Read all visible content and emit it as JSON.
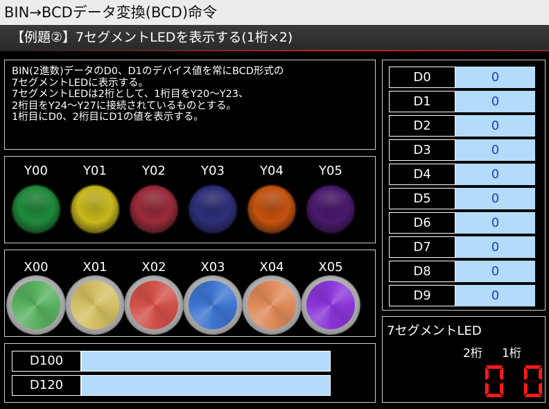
{
  "title": "BIN→BCDデータ変換(BCD)命令",
  "subtitle": "【例題②】7セグメントLEDを表示する(1桁×2)",
  "description": "BIN(2進数)データのD0、D1のデバイス値を常にBCD形式の\n7セグメントLEDに表示する。\n7セグメントLEDは2桁として、1桁目をY20～Y23、\n2桁目をY24～Y27に接続されているものとする。\n1桁目にD0、2桁目にD1の値を表示する。",
  "lamps": [
    {
      "label": "Y00",
      "color": "#1f8a3a"
    },
    {
      "label": "Y01",
      "color": "#c8b81c"
    },
    {
      "label": "Y02",
      "color": "#9a2a3a"
    },
    {
      "label": "Y03",
      "color": "#2e2f7a"
    },
    {
      "label": "Y04",
      "color": "#c4530f"
    },
    {
      "label": "Y05",
      "color": "#4a1a6e"
    }
  ],
  "switches": [
    {
      "label": "X00",
      "color": "#59b060"
    },
    {
      "label": "X01",
      "color": "#d4c064"
    },
    {
      "label": "X02",
      "color": "#d2504a"
    },
    {
      "label": "X03",
      "color": "#3e74d0"
    },
    {
      "label": "X04",
      "color": "#e08a5a"
    },
    {
      "label": "X05",
      "color": "#8a35d8"
    }
  ],
  "registers": [
    {
      "name": "D100",
      "value": ""
    },
    {
      "name": "D120",
      "value": ""
    }
  ],
  "devices": [
    {
      "name": "D0",
      "value": "0"
    },
    {
      "name": "D1",
      "value": "0"
    },
    {
      "name": "D2",
      "value": "0"
    },
    {
      "name": "D3",
      "value": "0"
    },
    {
      "name": "D4",
      "value": "0"
    },
    {
      "name": "D5",
      "value": "0"
    },
    {
      "name": "D6",
      "value": "0"
    },
    {
      "name": "D7",
      "value": "0"
    },
    {
      "name": "D8",
      "value": "0"
    },
    {
      "name": "D9",
      "value": "0"
    }
  ],
  "seg": {
    "title": "7セグメントLED",
    "digit2_label": "2桁",
    "digit1_label": "1桁",
    "digit2_value": "0",
    "digit1_value": "0",
    "seg_color": "#ff1a1a"
  }
}
